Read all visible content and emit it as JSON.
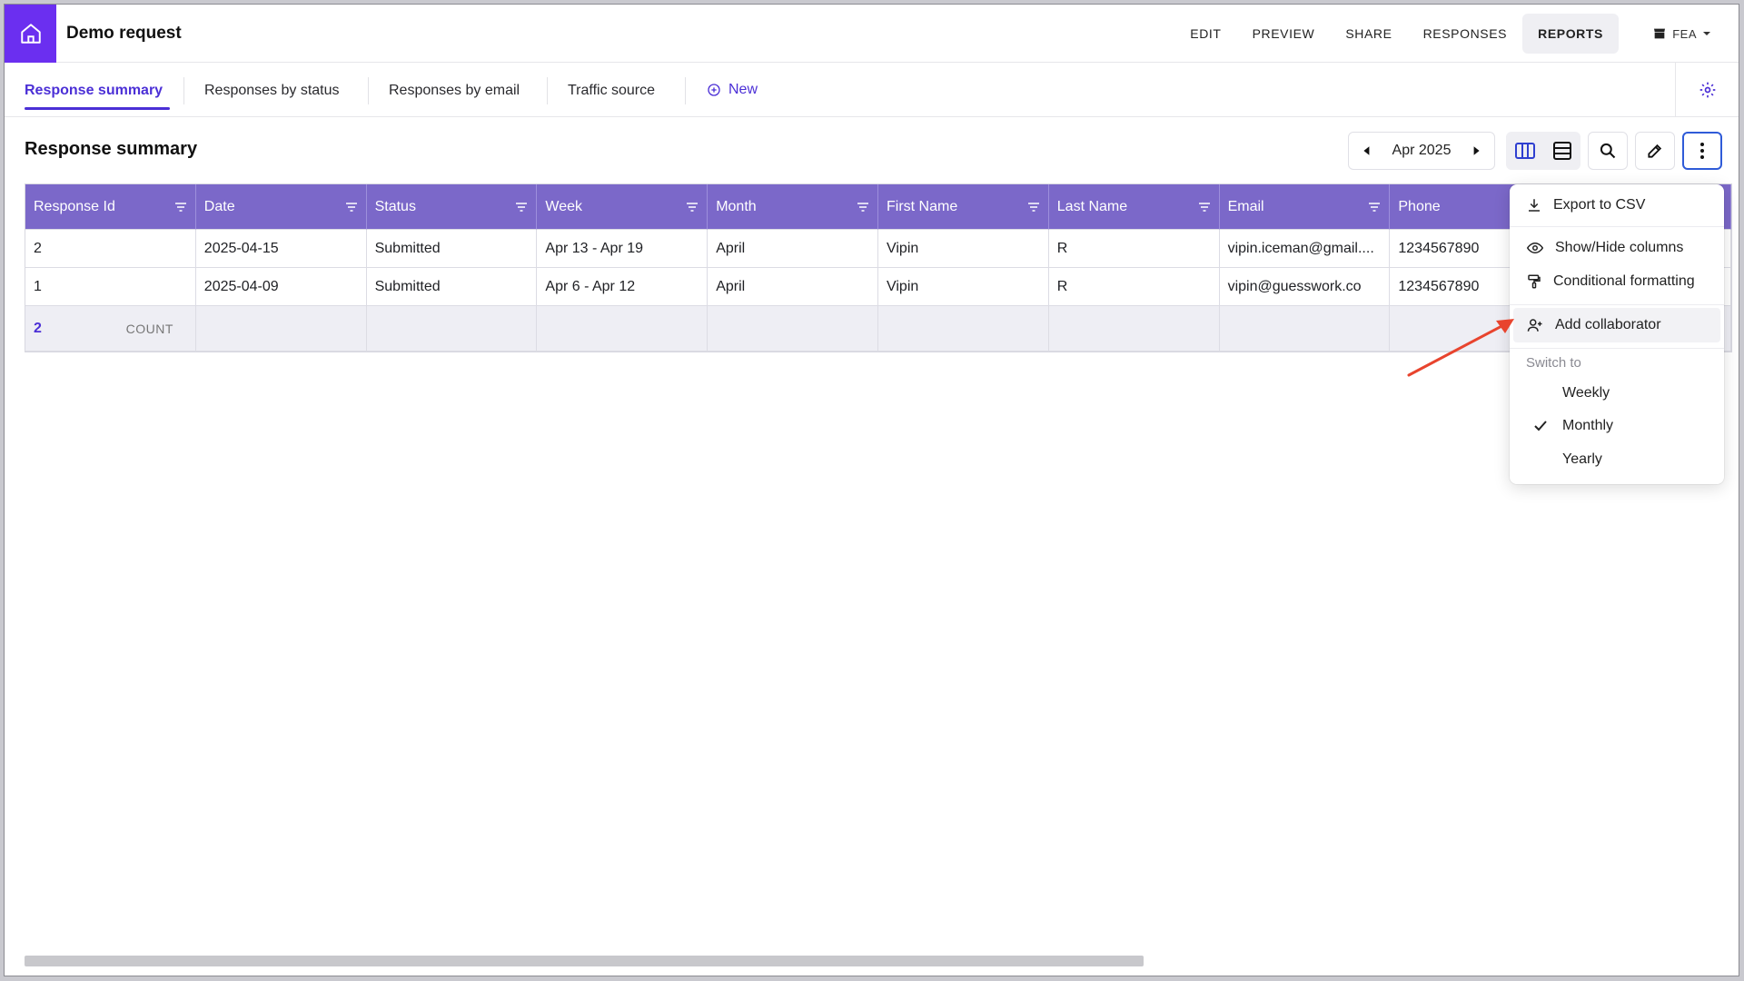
{
  "app": {
    "title": "Demo request"
  },
  "topnav": {
    "items": [
      "EDIT",
      "PREVIEW",
      "SHARE",
      "RESPONSES",
      "REPORTS"
    ],
    "active": "REPORTS",
    "org_label": "FEA"
  },
  "tabs": {
    "items": [
      "Response summary",
      "Responses by status",
      "Responses by email",
      "Traffic source"
    ],
    "active": "Response summary",
    "new_label": "New"
  },
  "toolbar": {
    "title": "Response summary",
    "period": "Apr 2025"
  },
  "table": {
    "columns": [
      "Response Id",
      "Date",
      "Status",
      "Week",
      "Month",
      "First Name",
      "Last Name",
      "Email",
      "Phone",
      ""
    ],
    "rows": [
      [
        "2",
        "2025-04-15",
        "Submitted",
        "Apr 13 - Apr 19",
        "April",
        "Vipin",
        "R",
        "vipin.iceman@gmail....",
        "1234567890",
        ""
      ],
      [
        "1",
        "2025-04-09",
        "Submitted",
        "Apr 6 - Apr 12",
        "April",
        "Vipin",
        "R",
        "vipin@guesswork.co",
        "1234567890",
        ""
      ]
    ],
    "footer": {
      "count_value": "2",
      "count_label": "COUNT"
    }
  },
  "menu": {
    "export_label": "Export to CSV",
    "showhide_label": "Show/Hide columns",
    "conditional_label": "Conditional formatting",
    "collaborator_label": "Add collaborator",
    "switch_label": "Switch to",
    "options": [
      "Weekly",
      "Monthly",
      "Yearly"
    ],
    "selected": "Monthly"
  },
  "colors": {
    "accent": "#6b2ff0",
    "header": "#7b68c9",
    "link": "#4b2fd6",
    "arrow": "#e8442e"
  },
  "icons": [
    "home-icon",
    "store-icon",
    "caret-down-icon",
    "plus-circle-icon",
    "gear-icon",
    "chevron-left-icon",
    "chevron-right-icon",
    "columns-icon",
    "rows-icon",
    "search-icon",
    "pencil-icon",
    "more-vertical-icon",
    "filter-icon",
    "download-icon",
    "eye-icon",
    "paint-roller-icon",
    "user-plus-icon",
    "check-icon"
  ]
}
